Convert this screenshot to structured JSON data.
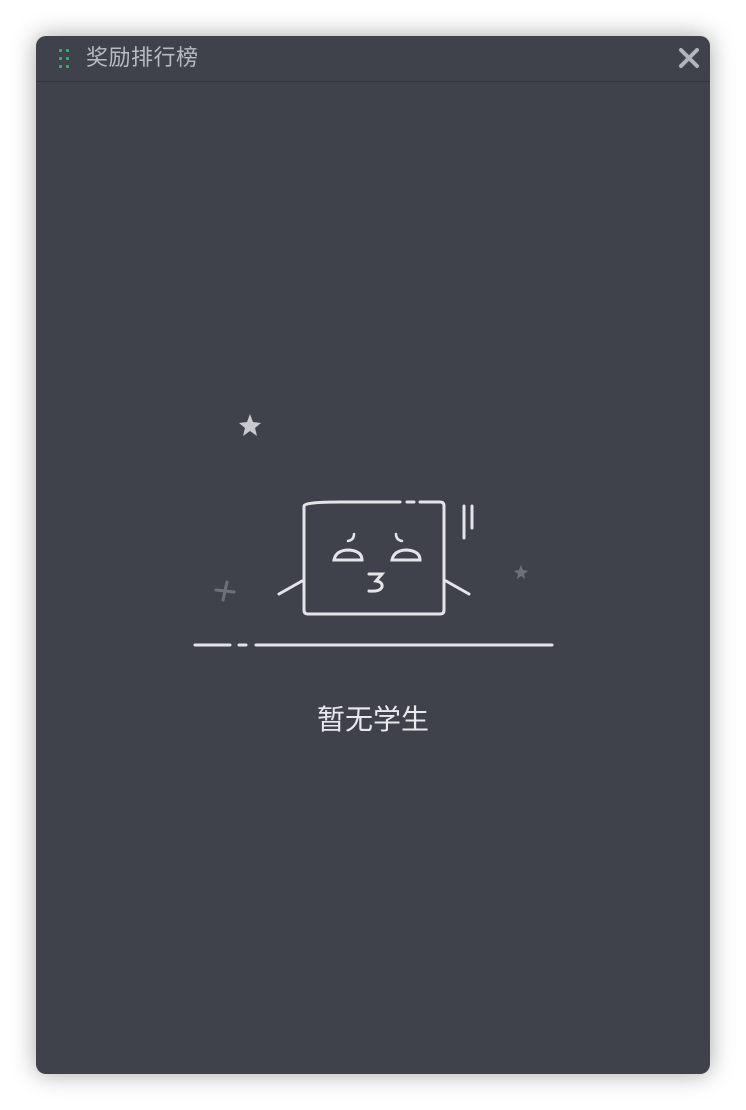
{
  "window": {
    "title": "奖励排行榜",
    "accent_color": "#2fb872",
    "background_color": "#3f414b"
  },
  "icons": {
    "drag": "grip-dots-icon",
    "close": "close-x-icon"
  },
  "empty_state": {
    "message": "暂无学生",
    "illustration": "sleepy-box-character"
  }
}
